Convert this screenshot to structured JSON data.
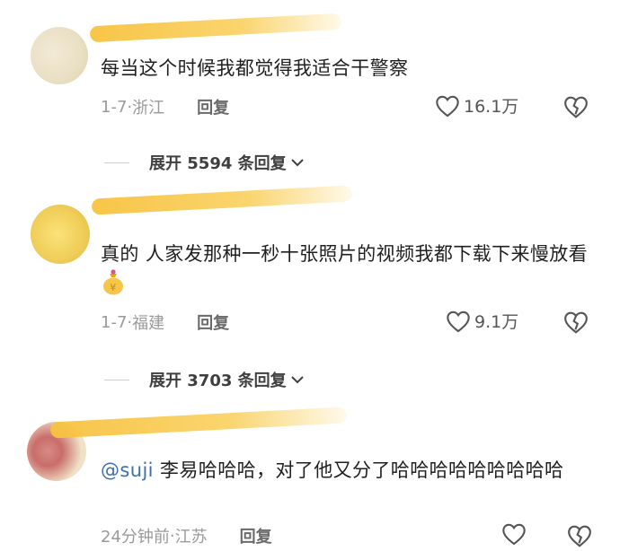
{
  "comments": [
    {
      "text": "每当这个时候我都觉得我适合干警察",
      "date": "1-7",
      "location": "浙江",
      "reply_label": "回复",
      "likes": "16.1万",
      "expand_label": "展开 5594 条回复"
    },
    {
      "text": "真的 人家发那种一秒十张照片的视频我都下载下来慢放看",
      "date": "1-7",
      "location": "福建",
      "reply_label": "回复",
      "likes": "9.1万",
      "expand_label": "展开 3703 条回复",
      "emoji": "money-bag-emoji"
    },
    {
      "mention": "@suji",
      "text": " 李易哈哈哈，对了他又分了哈哈哈哈哈哈哈哈哈",
      "time": "24分钟前",
      "location": "江苏",
      "reply_label": "回复"
    }
  ],
  "icons": {
    "like": "heart-outline-icon",
    "dislike": "broken-heart-icon",
    "expand": "chevron-down-icon"
  },
  "colors": {
    "name_blur": "#f7c23e",
    "mention": "#3d6fa8",
    "meta_gray": "#9a9a9a"
  }
}
